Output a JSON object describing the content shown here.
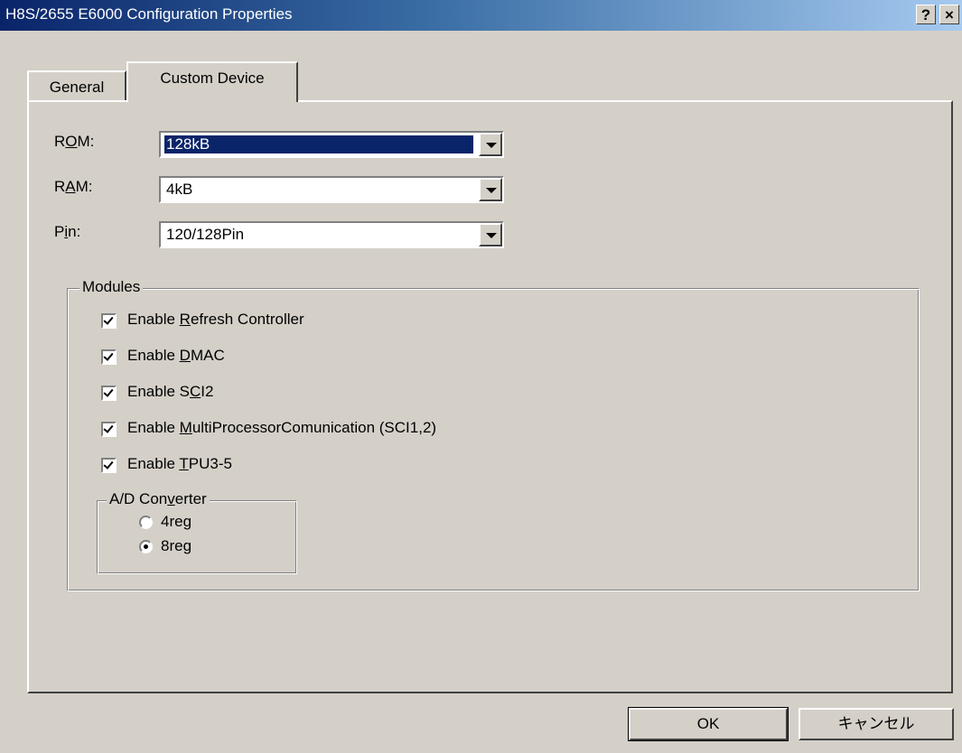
{
  "window": {
    "title": "H8S/2655 E6000 Configuration Properties",
    "help_button": "?",
    "close_button": "×"
  },
  "tabs": [
    {
      "label": "General",
      "active": false
    },
    {
      "label": "Custom Device",
      "active": true
    }
  ],
  "fields": {
    "rom": {
      "label_pre": "R",
      "label_key": "O",
      "label_post": "M:",
      "value": "128kB"
    },
    "ram": {
      "label_pre": "R",
      "label_key": "A",
      "label_post": "M:",
      "value": "4kB"
    },
    "pin": {
      "label_pre": "P",
      "label_key": "i",
      "label_post": "n:",
      "value": "120/128Pin"
    }
  },
  "modules": {
    "title": "Modules",
    "items": [
      {
        "pre": "Enable ",
        "key": "R",
        "post": "efresh Controller",
        "checked": true
      },
      {
        "pre": "Enable ",
        "key": "D",
        "post": "MAC",
        "checked": true
      },
      {
        "pre": "Enable S",
        "key": "C",
        "post": "I2",
        "checked": true
      },
      {
        "pre": "Enable ",
        "key": "M",
        "post": "ultiProcessorComunication (SCI1,2)",
        "checked": true
      },
      {
        "pre": "Enable ",
        "key": "T",
        "post": "PU3-5",
        "checked": true
      }
    ],
    "ad_converter": {
      "title_pre": "A/D Con",
      "title_key": "v",
      "title_post": "erter",
      "options": [
        {
          "label": "4reg",
          "selected": false
        },
        {
          "label": "8reg",
          "selected": true
        }
      ]
    }
  },
  "buttons": {
    "ok": "OK",
    "cancel": "キャンセル"
  }
}
